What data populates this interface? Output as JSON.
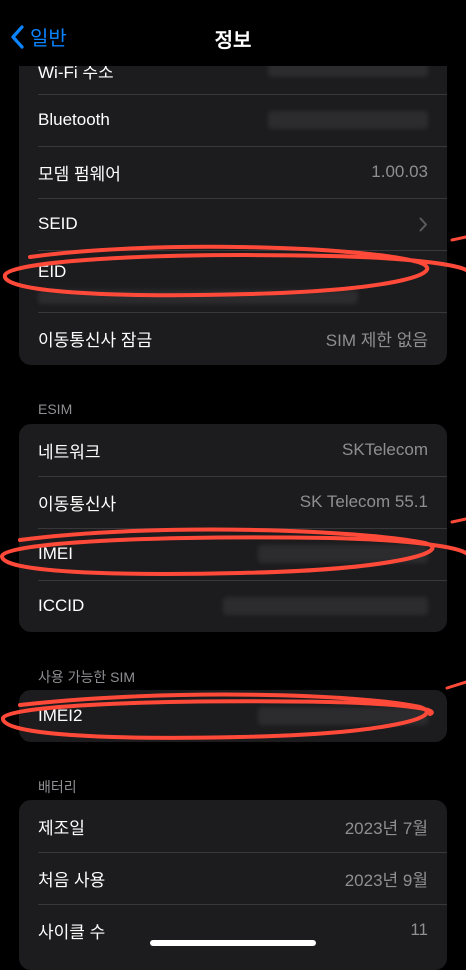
{
  "nav": {
    "back_label": "일반",
    "title": "정보"
  },
  "group1": {
    "wifi_label": "Wi-Fi 주소",
    "bluetooth_label": "Bluetooth",
    "modem_label": "모뎀 펌웨어",
    "modem_value": "1.00.03",
    "seid_label": "SEID",
    "eid_label": "EID",
    "carrier_lock_label": "이동통신사 잠금",
    "carrier_lock_value": "SIM 제한 없음"
  },
  "esim": {
    "header": "ESIM",
    "network_label": "네트워크",
    "network_value": "SKTelecom",
    "carrier_label": "이동통신사",
    "carrier_value": "SK Telecom 55.1",
    "imei_label": "IMEI",
    "iccid_label": "ICCID"
  },
  "available_sim": {
    "header": "사용 가능한 SIM",
    "imei2_label": "IMEI2"
  },
  "battery": {
    "header": "배터리",
    "manufacture_label": "제조일",
    "manufacture_value": "2023년 7월",
    "first_use_label": "처음 사용",
    "first_use_value": "2023년 9월",
    "cycle_label": "사이클 수",
    "cycle_value": "11"
  },
  "colors": {
    "accent": "#0a84ff",
    "annotation": "#ff4a3a",
    "cell": "#1c1c1e",
    "secondary_text": "#8e8e93"
  },
  "icons": {
    "back": "chevron-left-icon",
    "disclosure": "chevron-right-icon"
  }
}
